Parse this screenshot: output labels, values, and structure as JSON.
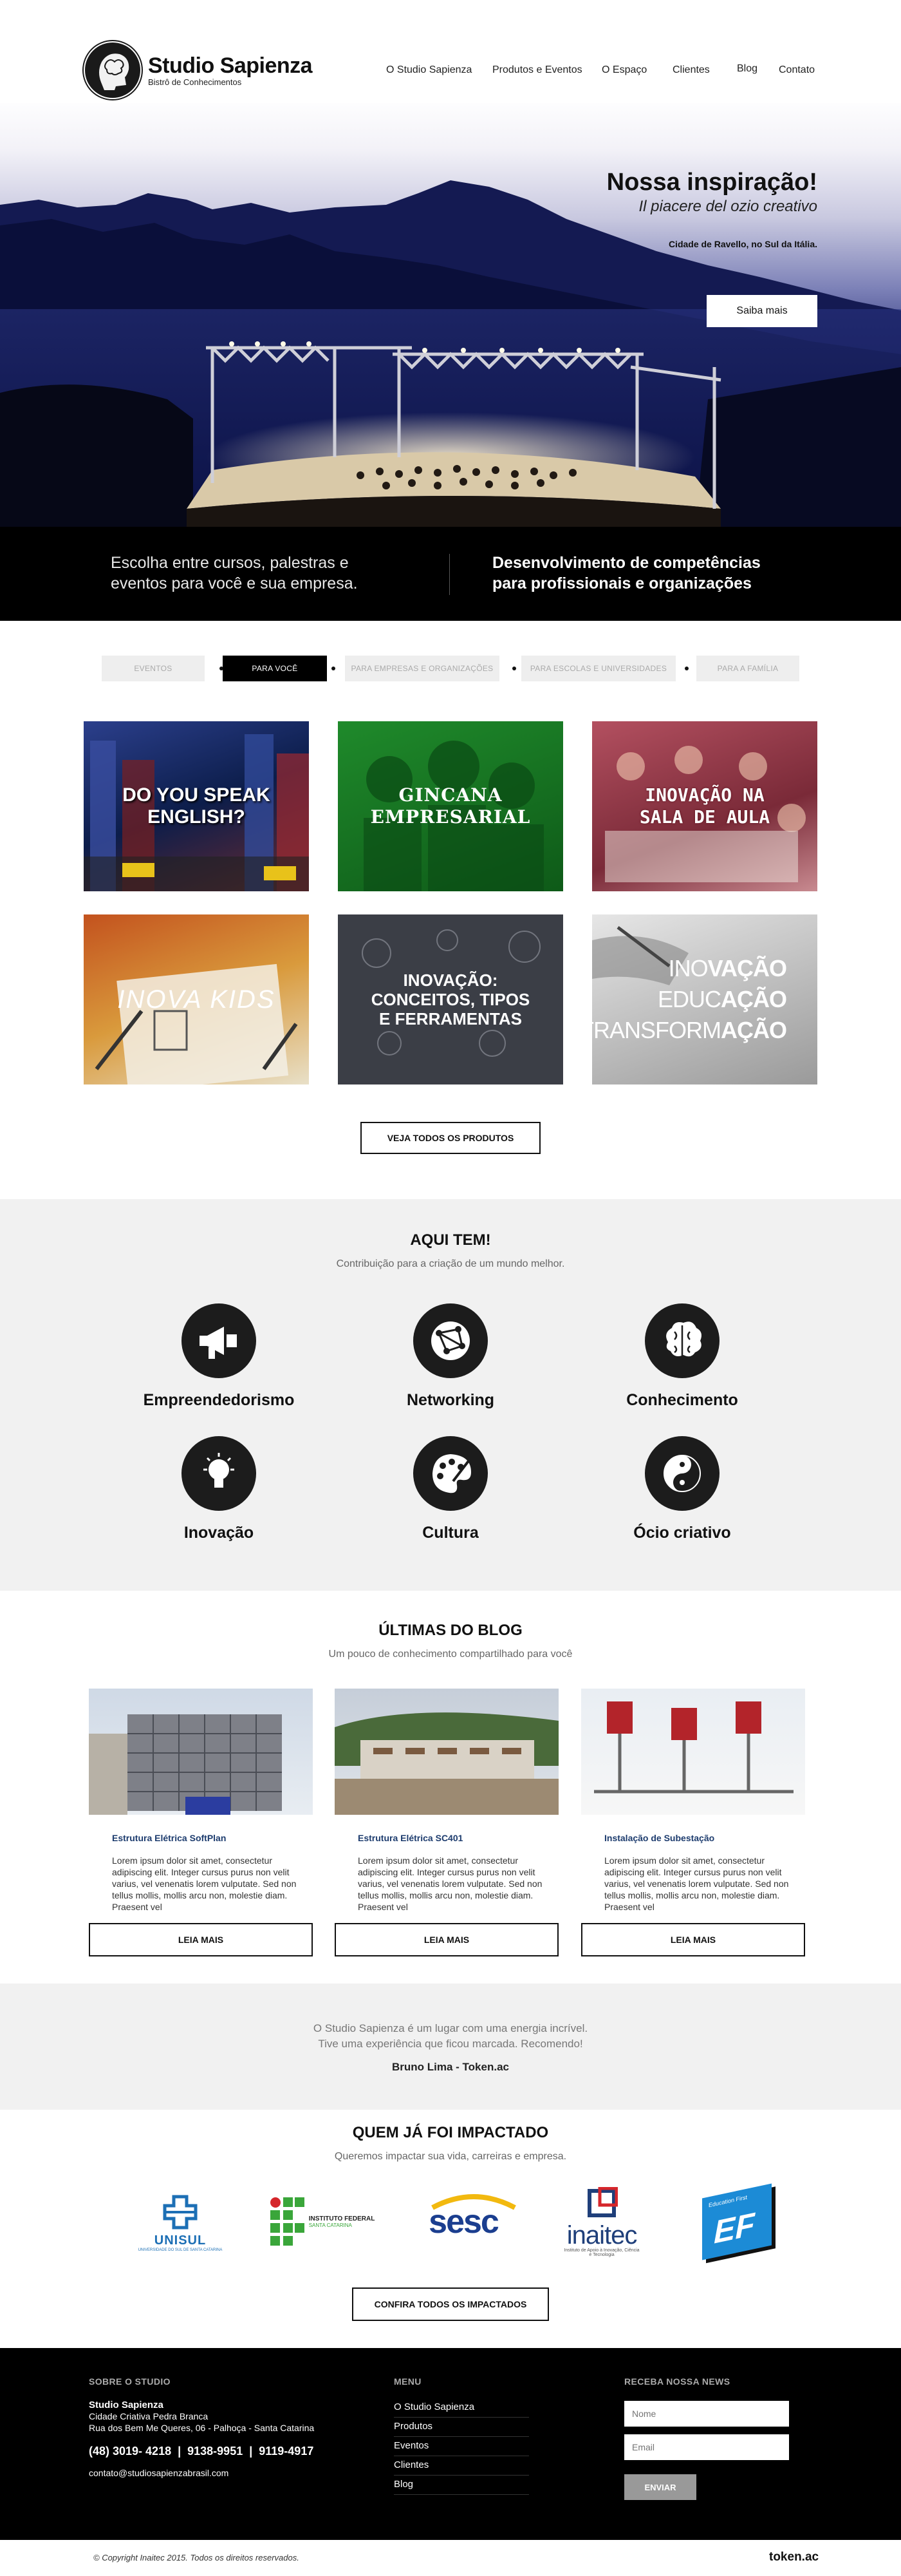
{
  "brand": {
    "title": "Studio Sapienza",
    "subtitle": "Bistrô de Conhecimentos"
  },
  "nav": [
    "O Studio Sapienza",
    "Produtos e Eventos",
    "O Espaço",
    "Clientes",
    "Blog",
    "Contato"
  ],
  "hero": {
    "title": "Nossa inspiração!",
    "italic": "Il piacere del ozio creativo",
    "place": "Cidade de Ravello, no Sul da Itália.",
    "button": "Saiba mais"
  },
  "strip": {
    "left": "Escolha entre cursos, palestras e eventos para você e sua empresa.",
    "right": "Desenvolvimento de competências para profissionais e organizações"
  },
  "tabs": [
    {
      "label": "Eventos",
      "active": false
    },
    {
      "label": "Para você",
      "active": true
    },
    {
      "label": "Para empresas e organizações",
      "active": false
    },
    {
      "label": "Para escolas e universidades",
      "active": false
    },
    {
      "label": "Para a família",
      "active": false
    }
  ],
  "products": [
    "DO YOU SPEAK ENGLISH?",
    "GINCANA EMPRESARIAL",
    "INOVAÇÃO NA SALA DE AULA",
    "INOVA KIDS",
    "INOVAÇÃO: CONCEITOS, TIPOS E FERRAMENTAS",
    {
      "line1a": "INO",
      "line1b": "VAÇÃO",
      "line2a": "EDUC",
      "line2b": "AÇÃO",
      "line3a": "TRANSFORM",
      "line3b": "AÇÃO"
    }
  ],
  "products_button": "Veja todos os produtos",
  "aqui": {
    "title": "AQUI TEM!",
    "subtitle": "Contribuição para a criação de um mundo melhor.",
    "features": [
      {
        "label": "Empreendedorismo",
        "icon": "megaphone-icon"
      },
      {
        "label": "Networking",
        "icon": "network-icon"
      },
      {
        "label": "Conhecimento",
        "icon": "brain-icon"
      },
      {
        "label": "Inovação",
        "icon": "lightbulb-icon"
      },
      {
        "label": "Cultura",
        "icon": "palette-icon"
      },
      {
        "label": "Ócio criativo",
        "icon": "yin-yang-icon"
      }
    ]
  },
  "blog": {
    "title": "ÚLTIMAS DO BLOG",
    "subtitle": "Um pouco de conhecimento compartilhado para você",
    "posts": [
      {
        "title": "Estrutura Elétrica SoftPlan",
        "body": "Lorem ipsum dolor sit amet, consectetur adipiscing elit. Integer cursus purus non velit varius, vel venenatis lorem vulputate. Sed non tellus mollis, mollis arcu non, molestie diam. Praesent vel",
        "button": "Leia mais"
      },
      {
        "title": "Estrutura Elétrica SC401",
        "body": "Lorem ipsum dolor sit amet, consectetur adipiscing elit. Integer cursus purus non velit varius, vel venenatis lorem vulputate. Sed non tellus mollis, mollis arcu non, molestie diam. Praesent vel",
        "button": "Leia mais"
      },
      {
        "title": "Instalação de Subestação",
        "body": "Lorem ipsum dolor sit amet, consectetur adipiscing elit. Integer cursus purus non velit varius, vel venenatis lorem vulputate. Sed non tellus mollis, mollis arcu non, molestie diam. Praesent vel",
        "button": "Leia mais"
      }
    ]
  },
  "testimonial": {
    "line1": "O Studio Sapienza é um lugar com uma energia incrível.",
    "line2": "Tive uma experiência que ficou marcada. Recomendo!",
    "author": "Bruno Lima - Token.ac"
  },
  "partners": {
    "title": "QUEM JÁ FOI IMPACTADO",
    "subtitle": "Queremos impactar sua vida, carreiras e empresa.",
    "logos": [
      {
        "name": "UNISUL",
        "caption": "UNIVERSIDADE DO SUL DE SANTA CATARINA"
      },
      {
        "name": "INSTITUTO FEDERAL",
        "caption": "SANTA CATARINA"
      },
      {
        "name": "sesc"
      },
      {
        "name": "inaitec",
        "caption": "Instituto de Apoio à Inovação, Ciência e Tecnologia"
      },
      {
        "name": "EF",
        "caption": "Education First"
      }
    ],
    "button": "Confira todos os impactados"
  },
  "footer": {
    "about_head": "SOBRE O STUDIO",
    "name": "Studio Sapienza",
    "addr1": "Cidade Criativa Pedra Branca",
    "addr2": "Rua dos Bem Me Queres, 06 - Palhoça - Santa Catarina",
    "phones": "(48) 3019- 4218  |  9138-9951  |  9119-4917",
    "email": "contato@studiosapienzabrasil.com",
    "menu_head": "MENU",
    "menu": [
      "O Studio Sapienza",
      "Produtos",
      "Eventos",
      "Clientes",
      "Blog"
    ],
    "news_head": "RECEBA NOSSA NEWS",
    "name_placeholder": "Nome",
    "email_placeholder": "Email",
    "send": "ENVIAR",
    "copyright": "© Copyright Inaitec 2015. Todos os direitos reservados.",
    "credit": "token.ac"
  }
}
